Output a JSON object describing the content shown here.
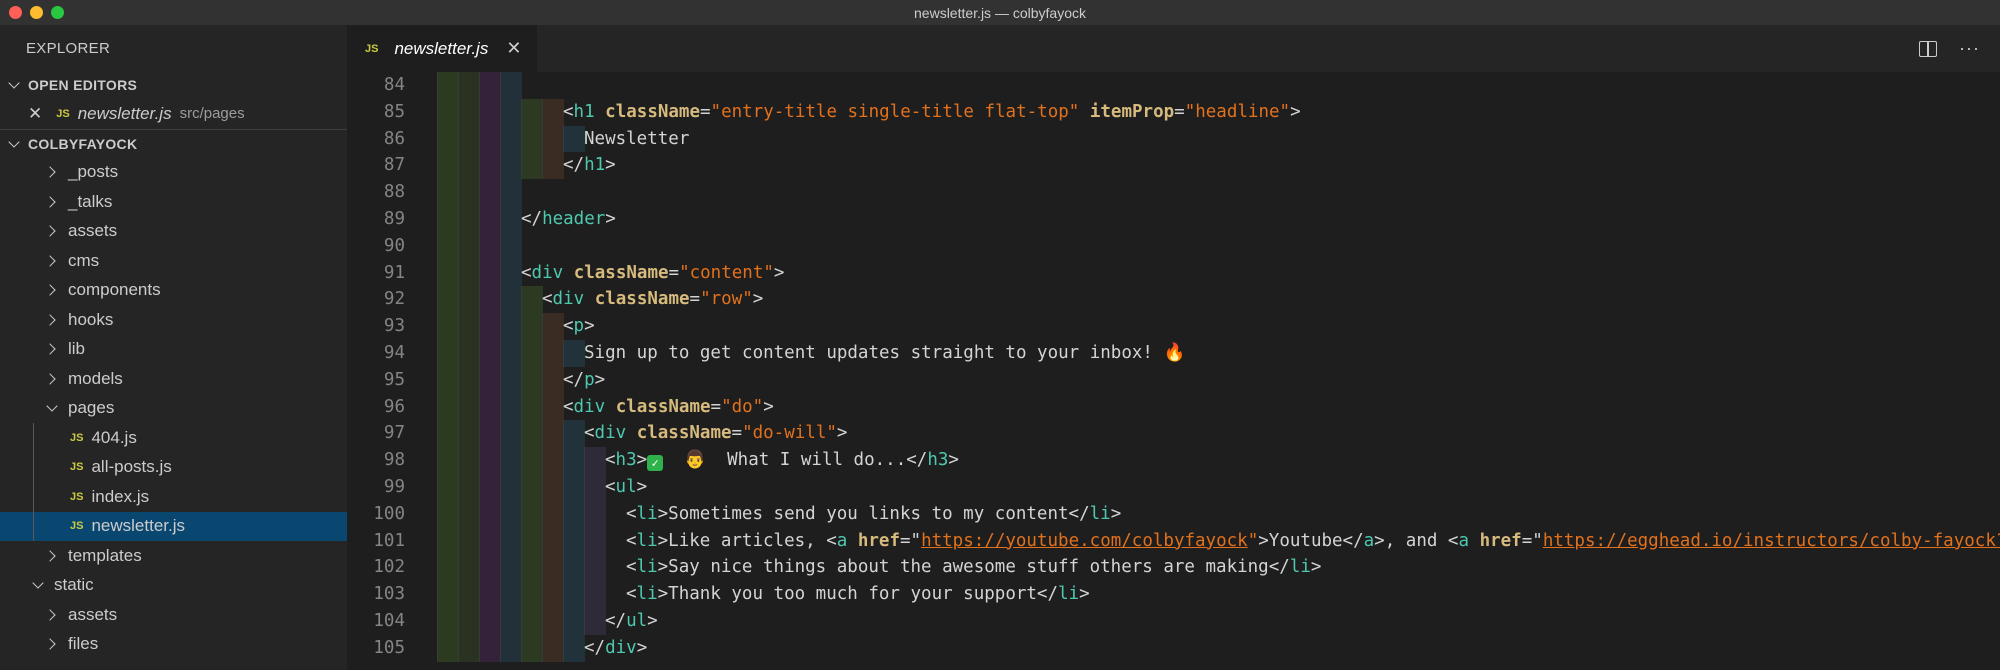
{
  "window": {
    "title": "newsletter.js — colbyfayock"
  },
  "sidebar": {
    "header": "EXPLORER",
    "open_editors": {
      "label": "OPEN EDITORS",
      "items": [
        {
          "name": "newsletter.js",
          "path": "src/pages",
          "badge": "JS"
        }
      ]
    },
    "project": {
      "label": "COLBYFAYOCK",
      "tree": [
        {
          "label": "_posts",
          "type": "folder",
          "depth": 1
        },
        {
          "label": "_talks",
          "type": "folder",
          "depth": 1
        },
        {
          "label": "assets",
          "type": "folder",
          "depth": 1
        },
        {
          "label": "cms",
          "type": "folder",
          "depth": 1
        },
        {
          "label": "components",
          "type": "folder",
          "depth": 1
        },
        {
          "label": "hooks",
          "type": "folder",
          "depth": 1
        },
        {
          "label": "lib",
          "type": "folder",
          "depth": 1
        },
        {
          "label": "models",
          "type": "folder",
          "depth": 1
        },
        {
          "label": "pages",
          "type": "folder-open",
          "depth": 1
        },
        {
          "label": "404.js",
          "type": "js",
          "depth": 2
        },
        {
          "label": "all-posts.js",
          "type": "js",
          "depth": 2
        },
        {
          "label": "index.js",
          "type": "js",
          "depth": 2
        },
        {
          "label": "newsletter.js",
          "type": "js",
          "depth": 2,
          "selected": true
        },
        {
          "label": "templates",
          "type": "folder",
          "depth": 1
        },
        {
          "label": "static",
          "type": "folder-open",
          "depth": 0
        },
        {
          "label": "assets",
          "type": "folder",
          "depth": 1
        },
        {
          "label": "files",
          "type": "folder",
          "depth": 1
        }
      ]
    }
  },
  "editor": {
    "tab": {
      "badge": "JS",
      "label": "newsletter.js"
    },
    "lines": [
      {
        "n": "84",
        "indent": 4,
        "tokens": []
      },
      {
        "n": "85",
        "indent": 6,
        "tokens": [
          [
            "br",
            "<"
          ],
          [
            "tag",
            "h1"
          ],
          [
            "text",
            " "
          ],
          [
            "attr",
            "className"
          ],
          [
            "br",
            "="
          ],
          [
            "str",
            "\"entry-title single-title flat-top\""
          ],
          [
            "text",
            " "
          ],
          [
            "attr",
            "itemProp"
          ],
          [
            "br",
            "="
          ],
          [
            "str",
            "\"headline\""
          ],
          [
            "br",
            ">"
          ]
        ]
      },
      {
        "n": "86",
        "indent": 7,
        "tokens": [
          [
            "text",
            "Newsletter"
          ]
        ]
      },
      {
        "n": "87",
        "indent": 6,
        "tokens": [
          [
            "br",
            "</"
          ],
          [
            "tag",
            "h1"
          ],
          [
            "br",
            ">"
          ]
        ]
      },
      {
        "n": "88",
        "indent": 4,
        "tokens": []
      },
      {
        "n": "89",
        "indent": 4,
        "tokens": [
          [
            "br",
            "</"
          ],
          [
            "tag",
            "header"
          ],
          [
            "br",
            ">"
          ]
        ]
      },
      {
        "n": "90",
        "indent": 4,
        "tokens": []
      },
      {
        "n": "91",
        "indent": 4,
        "tokens": [
          [
            "br",
            "<"
          ],
          [
            "tag",
            "div"
          ],
          [
            "text",
            " "
          ],
          [
            "attr",
            "className"
          ],
          [
            "br",
            "="
          ],
          [
            "str",
            "\"content\""
          ],
          [
            "br",
            ">"
          ]
        ]
      },
      {
        "n": "92",
        "indent": 5,
        "tokens": [
          [
            "br",
            "<"
          ],
          [
            "tag",
            "div"
          ],
          [
            "text",
            " "
          ],
          [
            "attr",
            "className"
          ],
          [
            "br",
            "="
          ],
          [
            "str",
            "\"row\""
          ],
          [
            "br",
            ">"
          ]
        ]
      },
      {
        "n": "93",
        "indent": 6,
        "tokens": [
          [
            "br",
            "<"
          ],
          [
            "tag",
            "p"
          ],
          [
            "br",
            ">"
          ]
        ]
      },
      {
        "n": "94",
        "indent": 7,
        "tokens": [
          [
            "text",
            "Sign up to get content updates straight to your inbox! "
          ],
          [
            "fire",
            "🔥"
          ]
        ]
      },
      {
        "n": "95",
        "indent": 6,
        "tokens": [
          [
            "br",
            "</"
          ],
          [
            "tag",
            "p"
          ],
          [
            "br",
            ">"
          ]
        ]
      },
      {
        "n": "96",
        "indent": 6,
        "tokens": [
          [
            "br",
            "<"
          ],
          [
            "tag",
            "div"
          ],
          [
            "text",
            " "
          ],
          [
            "attr",
            "className"
          ],
          [
            "br",
            "="
          ],
          [
            "str",
            "\"do\""
          ],
          [
            "br",
            ">"
          ]
        ]
      },
      {
        "n": "97",
        "indent": 7,
        "tokens": [
          [
            "br",
            "<"
          ],
          [
            "tag",
            "div"
          ],
          [
            "text",
            " "
          ],
          [
            "attr",
            "className"
          ],
          [
            "br",
            "="
          ],
          [
            "str",
            "\"do-will\""
          ],
          [
            "br",
            ">"
          ]
        ]
      },
      {
        "n": "98",
        "indent": 8,
        "tokens": [
          [
            "br",
            "<"
          ],
          [
            "tag",
            "h3"
          ],
          [
            "br",
            ">"
          ],
          [
            "check",
            "✓"
          ],
          [
            "text",
            "  "
          ],
          [
            "person",
            "👨"
          ],
          [
            "text",
            "  What I will do...</"
          ],
          [
            "tag",
            "h3"
          ],
          [
            "br",
            ">"
          ]
        ]
      },
      {
        "n": "99",
        "indent": 8,
        "tokens": [
          [
            "br",
            "<"
          ],
          [
            "tag",
            "ul"
          ],
          [
            "br",
            ">"
          ]
        ]
      },
      {
        "n": "100",
        "indent": 9,
        "tokens": [
          [
            "br",
            "<"
          ],
          [
            "tag",
            "li"
          ],
          [
            "br",
            ">"
          ],
          [
            "text",
            "Sometimes send you links to my content</"
          ],
          [
            "tag",
            "li"
          ],
          [
            "br",
            ">"
          ]
        ]
      },
      {
        "n": "101",
        "indent": 9,
        "tokens": [
          [
            "br",
            "<"
          ],
          [
            "tag",
            "li"
          ],
          [
            "br",
            ">"
          ],
          [
            "text",
            "Like articles, <"
          ],
          [
            "tag",
            "a"
          ],
          [
            "text",
            " "
          ],
          [
            "attr",
            "href"
          ],
          [
            "br",
            "=\""
          ],
          [
            "link",
            "https://youtube.com/colbyfayock"
          ],
          [
            "str",
            "\""
          ],
          [
            "br",
            ">"
          ],
          [
            "text",
            "Youtube</"
          ],
          [
            "tag",
            "a"
          ],
          [
            "br",
            ">"
          ],
          [
            "text",
            ", and <"
          ],
          [
            "tag",
            "a"
          ],
          [
            "text",
            " "
          ],
          [
            "attr",
            "href"
          ],
          [
            "br",
            "=\""
          ],
          [
            "link",
            "https://egghead.io/instructors/colby-fayock?"
          ]
        ]
      },
      {
        "n": "102",
        "indent": 9,
        "tokens": [
          [
            "br",
            "<"
          ],
          [
            "tag",
            "li"
          ],
          [
            "br",
            ">"
          ],
          [
            "text",
            "Say nice things about the awesome stuff others are making</"
          ],
          [
            "tag",
            "li"
          ],
          [
            "br",
            ">"
          ]
        ]
      },
      {
        "n": "103",
        "indent": 9,
        "tokens": [
          [
            "br",
            "<"
          ],
          [
            "tag",
            "li"
          ],
          [
            "br",
            ">"
          ],
          [
            "text",
            "Thank you too much for your support</"
          ],
          [
            "tag",
            "li"
          ],
          [
            "br",
            ">"
          ]
        ]
      },
      {
        "n": "104",
        "indent": 8,
        "tokens": [
          [
            "br",
            "</"
          ],
          [
            "tag",
            "ul"
          ],
          [
            "br",
            ">"
          ]
        ]
      },
      {
        "n": "105",
        "indent": 7,
        "tokens": [
          [
            "br",
            "</"
          ],
          [
            "tag",
            "div"
          ],
          [
            "br",
            ">"
          ]
        ]
      }
    ]
  },
  "colors": {
    "tag": "#4ec9b0",
    "attr": "#d7ba7d",
    "string": "#e2711d",
    "selection": "#094771"
  }
}
